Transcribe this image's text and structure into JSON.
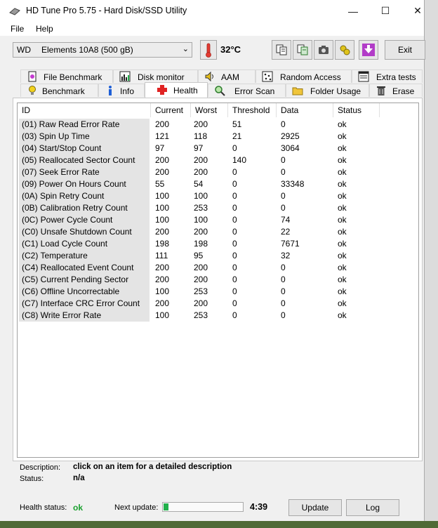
{
  "window": {
    "title": "HD Tune Pro 5.75 - Hard Disk/SSD Utility",
    "minimize_glyph": "—",
    "maximize_glyph": "☐",
    "close_glyph": "✕"
  },
  "menu": [
    "File",
    "Help"
  ],
  "toolbar": {
    "drive_prefix": "WD",
    "drive_name": "Elements 10A8 (500 gB)",
    "temperature": "32°C",
    "exit_label": "Exit"
  },
  "tabs_top": [
    "File Benchmark",
    "Disk monitor",
    "AAM",
    "Random Access",
    "Extra tests"
  ],
  "tabs_bottom": [
    "Benchmark",
    "Info",
    "Health",
    "Error Scan",
    "Folder Usage",
    "Erase"
  ],
  "active_tab": "Health",
  "table": {
    "headers": [
      "ID",
      "Current",
      "Worst",
      "Threshold",
      "Data",
      "Status"
    ],
    "rows": [
      [
        "(01) Raw Read Error Rate",
        "200",
        "200",
        "51",
        "0",
        "ok"
      ],
      [
        "(03) Spin Up Time",
        "121",
        "118",
        "21",
        "2925",
        "ok"
      ],
      [
        "(04) Start/Stop Count",
        "97",
        "97",
        "0",
        "3064",
        "ok"
      ],
      [
        "(05) Reallocated Sector Count",
        "200",
        "200",
        "140",
        "0",
        "ok"
      ],
      [
        "(07) Seek Error Rate",
        "200",
        "200",
        "0",
        "0",
        "ok"
      ],
      [
        "(09) Power On Hours Count",
        "55",
        "54",
        "0",
        "33348",
        "ok"
      ],
      [
        "(0A) Spin Retry Count",
        "100",
        "100",
        "0",
        "0",
        "ok"
      ],
      [
        "(0B) Calibration Retry Count",
        "100",
        "253",
        "0",
        "0",
        "ok"
      ],
      [
        "(0C) Power Cycle Count",
        "100",
        "100",
        "0",
        "74",
        "ok"
      ],
      [
        "(C0) Unsafe Shutdown Count",
        "200",
        "200",
        "0",
        "22",
        "ok"
      ],
      [
        "(C1) Load Cycle Count",
        "198",
        "198",
        "0",
        "7671",
        "ok"
      ],
      [
        "(C2) Temperature",
        "111",
        "95",
        "0",
        "32",
        "ok"
      ],
      [
        "(C4) Reallocated Event Count",
        "200",
        "200",
        "0",
        "0",
        "ok"
      ],
      [
        "(C5) Current Pending Sector",
        "200",
        "200",
        "0",
        "0",
        "ok"
      ],
      [
        "(C6) Offline Uncorrectable",
        "100",
        "253",
        "0",
        "0",
        "ok"
      ],
      [
        "(C7) Interface CRC Error Count",
        "200",
        "200",
        "0",
        "0",
        "ok"
      ],
      [
        "(C8) Write Error Rate",
        "100",
        "253",
        "0",
        "0",
        "ok"
      ]
    ]
  },
  "footer": {
    "description_label": "Description:",
    "description_value": "click on an item for a detailed description",
    "status_label": "Status:",
    "status_value": "n/a",
    "health_status_label": "Health status:",
    "health_status_value": "ok",
    "next_update_label": "Next update:",
    "next_update_progress": 0.06,
    "countdown": "4:39",
    "update_button": "Update",
    "log_button": "Log"
  },
  "colors": {
    "health_ok": "#1aa12f",
    "progress_fill": "#22b14c",
    "id_cell_bg": "#e4e4e4"
  },
  "icons": {
    "app": "hard-disk-icon",
    "thermometer": "thermometer-icon",
    "copy_info": "copy-icon",
    "copy_text": "copy-text-icon",
    "screenshot": "camera-icon",
    "options": "options-icon",
    "save": "download-icon"
  }
}
